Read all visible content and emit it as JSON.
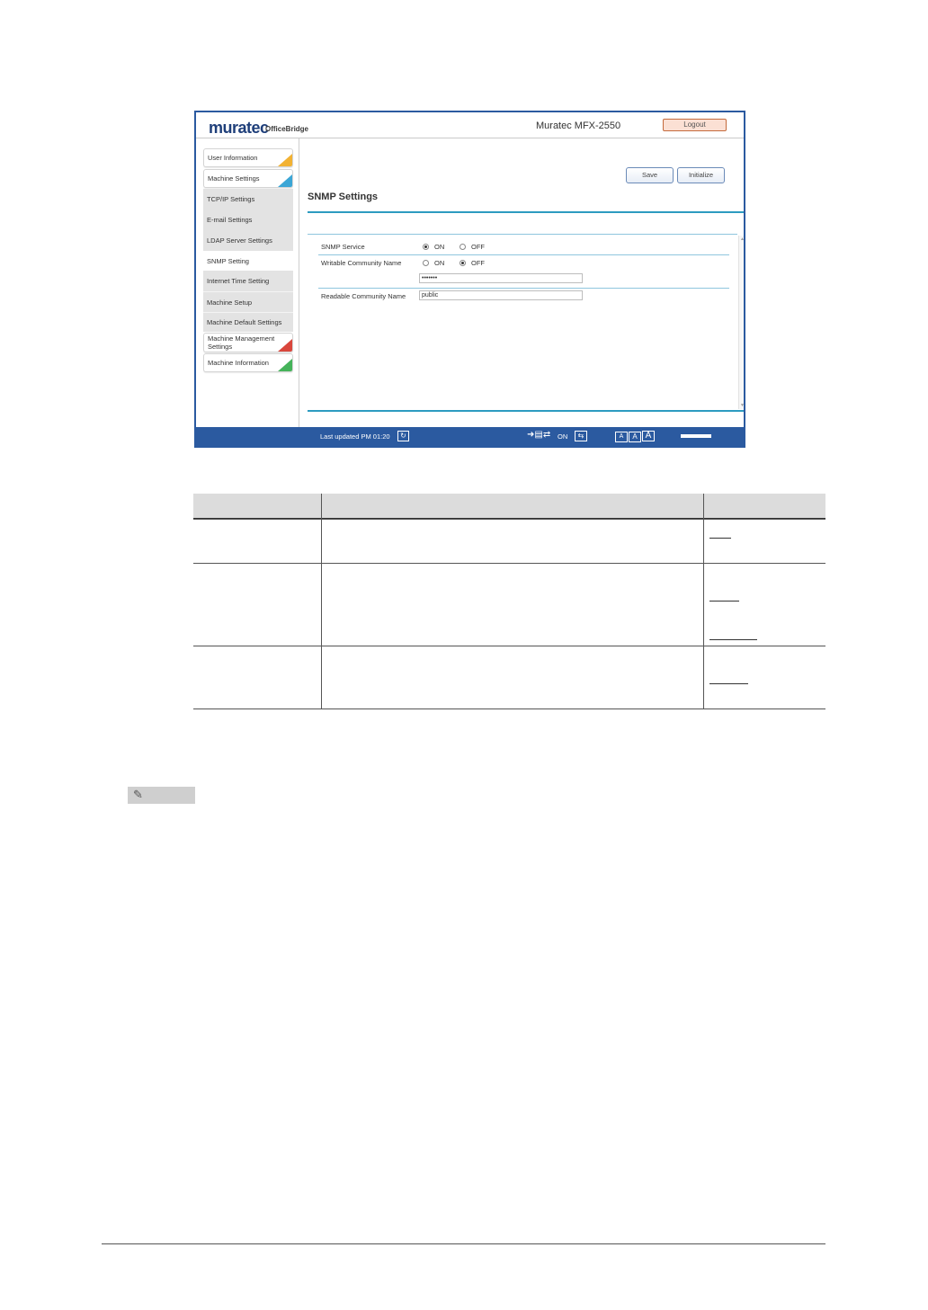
{
  "app": {
    "logo_main": "muratec",
    "logo_sub": "OfficeBridge",
    "model": "Muratec MFX-2550",
    "logout_label": "Logout"
  },
  "sidebar": {
    "items": [
      {
        "label": "User Information"
      },
      {
        "label": "Machine Settings"
      },
      {
        "label": "TCP/IP Settings"
      },
      {
        "label": "E-mail Settings"
      },
      {
        "label": "LDAP Server Settings"
      },
      {
        "label": "SNMP Setting"
      },
      {
        "label": "Internet Time Setting"
      },
      {
        "label": "Machine Setup"
      },
      {
        "label": "Machine Default Settings"
      },
      {
        "label": "Machine Management Settings"
      },
      {
        "label": "Machine Information"
      }
    ]
  },
  "toolbar": {
    "save_label": "Save",
    "initialize_label": "Initialize"
  },
  "page": {
    "title": "SNMP Settings"
  },
  "form": {
    "snmp_service": {
      "label": "SNMP Service",
      "on_label": "ON",
      "off_label": "OFF",
      "selected": "ON"
    },
    "writable": {
      "label": "Writable Community Name",
      "on_label": "ON",
      "off_label": "OFF",
      "selected": "OFF",
      "value": "•••••••"
    },
    "readable": {
      "label": "Readable Community Name",
      "value": "public"
    }
  },
  "footer": {
    "last_updated": "Last updated PM 01:20",
    "toggle_state": "ON",
    "font_a_small": "A",
    "font_a_medium": "A",
    "font_a_large": "A"
  },
  "colors": {
    "brand_blue": "#2b5aa0",
    "accent_teal": "#2d9bc0",
    "corner_yellow": "#f2b233",
    "corner_blue": "#3ba6d6",
    "corner_red": "#d9463c",
    "corner_green": "#45b35a"
  }
}
